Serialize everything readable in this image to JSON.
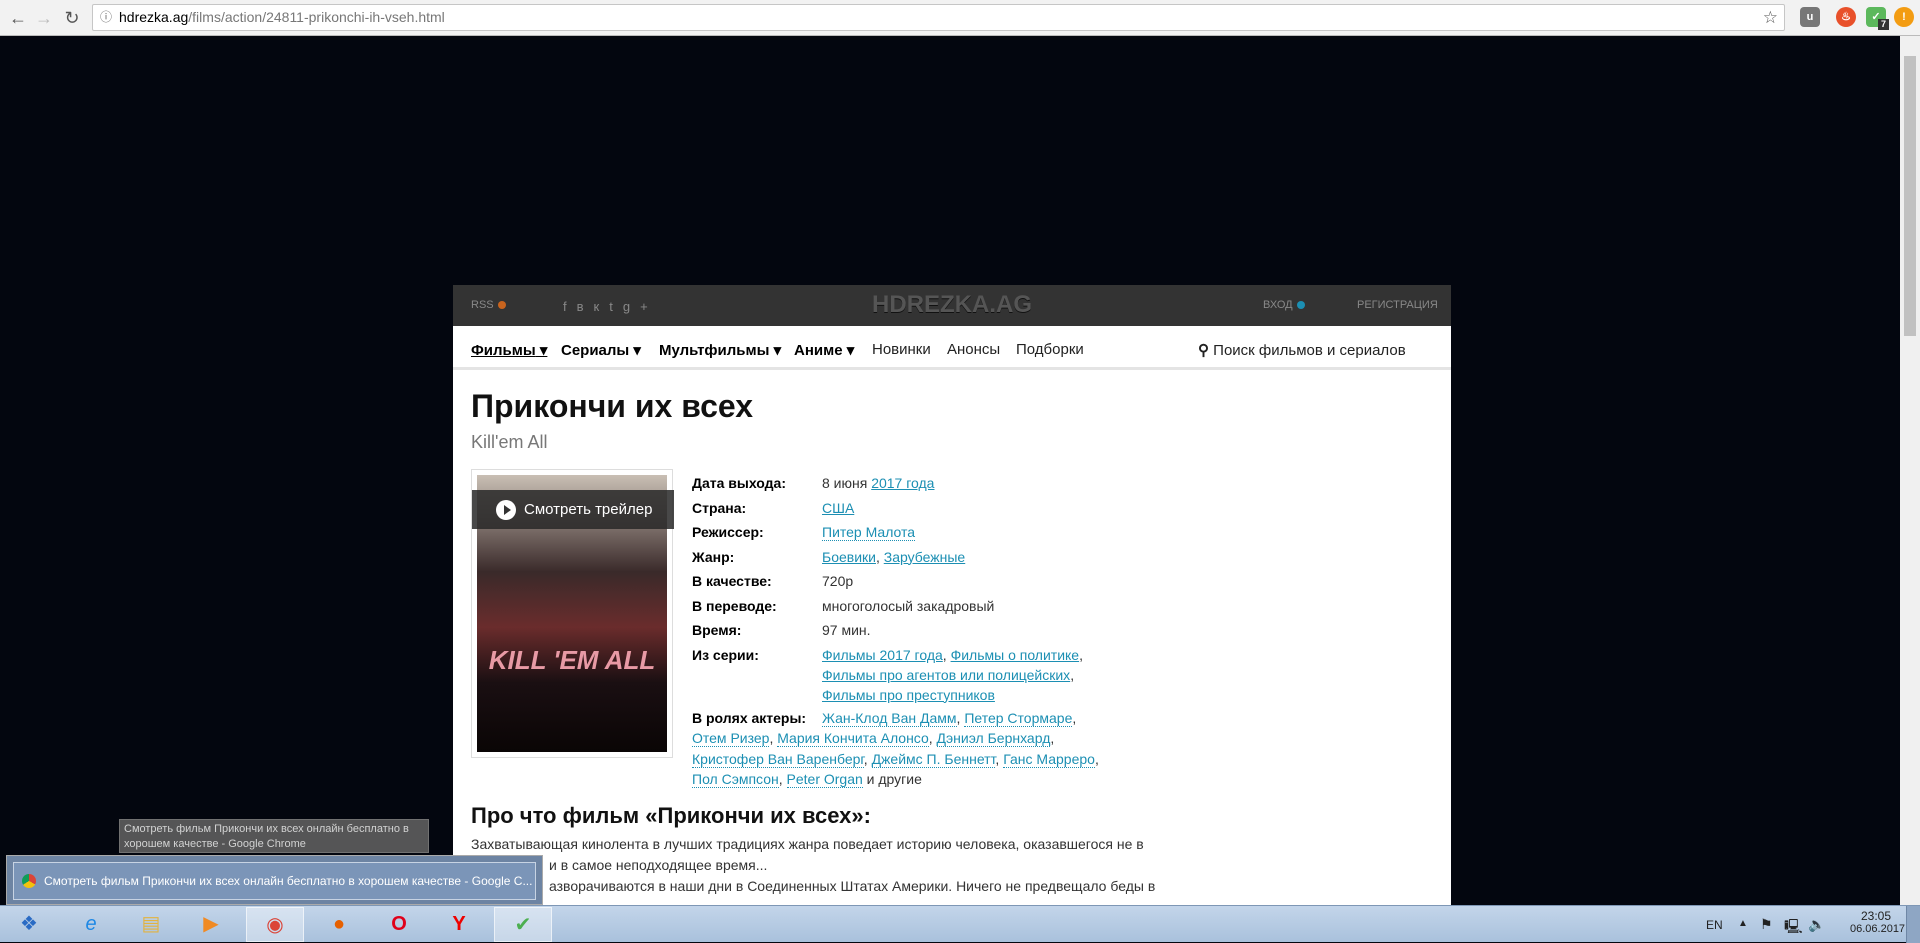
{
  "browser": {
    "url_host": "hdrezka.ag",
    "url_path": "/films/action/24811-prikonchi-ih-vseh.html",
    "extension_badge": "7",
    "icons": [
      "back-icon",
      "forward-icon",
      "reload-icon",
      "info-icon",
      "star-icon",
      "ublock-icon",
      "fire-extension-icon",
      "adguard-icon",
      "alert-extension-icon"
    ]
  },
  "site": {
    "rss": "RSS",
    "logo": "HDREZKA.AG",
    "login": "ВХОД",
    "register": "РЕГИСТРАЦИЯ",
    "nav": [
      "Фильмы",
      "Сериалы",
      "Мультфильмы",
      "Аниме",
      "Новинки",
      "Анонсы",
      "Подборки"
    ],
    "search_placeholder": "Поиск фильмов и сериалов",
    "title": "Прикончи их всех",
    "original_title": "Kill'em All",
    "poster_text": "KILL 'EM ALL",
    "trailer": "Смотреть трейлер",
    "info": {
      "release_label": "Дата выхода:",
      "release_day": "8 июня",
      "release_year": "2017 года",
      "country_label": "Страна:",
      "country": "США",
      "director_label": "Режиссер:",
      "director": "Питер Малота",
      "genre_label": "Жанр:",
      "genres": [
        "Боевики",
        "Зарубежные"
      ],
      "quality_label": "В качестве:",
      "quality": "720p",
      "translation_label": "В переводе:",
      "translation": "многоголосый закадровый",
      "duration_label": "Время:",
      "duration": "97 мин.",
      "series_label": "Из серии:",
      "series": [
        "Фильмы 2017 года",
        "Фильмы о политике",
        "Фильмы про агентов или полицейских",
        "Фильмы про преступников"
      ],
      "actors_label": "В ролях актеры:",
      "actors": [
        "Жан-Клод Ван Дамм",
        "Петер Стормаре",
        "Отем Ризер",
        "Мария Кончита Алонсо",
        "Дэниэл Бернхард",
        "Кристофер Ван Варенберг",
        "Джеймс П. Беннетт",
        "Ганс Марреро",
        "Пол Сэмпсон",
        "Peter Organ"
      ],
      "actors_more": "и другие"
    },
    "about_title": "Про что фильм «Прикончи их всех»:",
    "description": [
      "Захватывающая кинолента в лучших традициях жанра поведает историю человека, оказавшегося не в",
      "и в самое неподходящее время...",
      "азворачиваются в наши дни в Соединенных Штатах Америки. Ничего не предвещало беды в"
    ]
  },
  "tooltip": "Смотреть фильм Прикончи их всех онлайн бесплатно в хорошем качестве - Google Chrome",
  "preview": "Смотреть фильм Прикончи их всех онлайн бесплатно в хорошем качестве - Google C...",
  "taskbar": {
    "apps": [
      "start",
      "internet-explorer",
      "file-explorer",
      "media-player",
      "chrome",
      "firefox",
      "opera",
      "yandex",
      "adguard"
    ],
    "lang": "EN",
    "time": "23:05",
    "date": "06.06.2017"
  },
  "colors": {
    "link": "#1c8fb3",
    "page_bg": "#03060f",
    "header": "#333333"
  }
}
